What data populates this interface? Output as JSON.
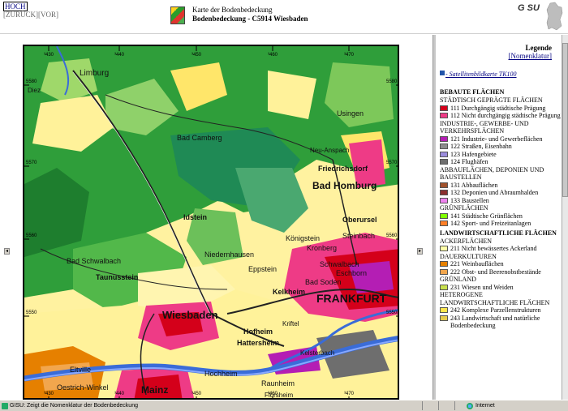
{
  "header": {
    "nav": {
      "hoch": "HOCH",
      "zurueck": "[ZURÜCK]",
      "vor": "[VOR]"
    },
    "subtitle": "Karte der Bodenbedeckung",
    "title": "Bodenbedeckung - C5914 Wiesbaden",
    "logo_text": "G SU"
  },
  "map": {
    "grid_top": [
      "³430",
      "³440",
      "³450",
      "³460",
      "³470"
    ],
    "grid_bottom": [
      "³430",
      "³440",
      "³450",
      "³460",
      "³470"
    ],
    "grid_left": [
      "5580",
      "5570",
      "5560",
      "5550"
    ],
    "grid_right": [
      "5580",
      "5570",
      "5560",
      "5550"
    ],
    "places": [
      "Limburg",
      "Idstein",
      "Usingen",
      "Bad Camberg",
      "Neu-Anspach",
      "Friedrichsdorf",
      "Bad Homburg",
      "Oberursel",
      "Königstein",
      "Kronberg",
      "Steinbach",
      "Niedernhausen",
      "Bad Schwalbach",
      "Taunusstein",
      "Eppstein",
      "Schwalbach",
      "Eschborn",
      "Bad Soden",
      "Kelkheim",
      "FRANKFURT",
      "Wiesbaden",
      "Hofheim",
      "Hattersheim",
      "Kriftel",
      "Kelsterbach",
      "Eltville",
      "Oestrich-Winkel",
      "Hochheim",
      "Raunheim",
      "Flörsheim",
      "Mainz",
      "Diez"
    ]
  },
  "legend": {
    "title": "Legende",
    "nomenklatur_link": "[Nomenklatur]",
    "satellite_link": "- Satellitenbildkarte TK100",
    "items": [
      {
        "kind": "h1",
        "text": "BEBAUTE FLÄCHEN"
      },
      {
        "kind": "h2",
        "text": "STÄDTISCH GEPRÄGTE FLÄCHEN"
      },
      {
        "kind": "item",
        "text": "111 Durchgängig städtische Prägung",
        "color": "#d4001a"
      },
      {
        "kind": "item",
        "text": "112 Nicht durchgängig städtische Prägung",
        "color": "#ee3b86"
      },
      {
        "kind": "h2",
        "text": "INDUSTRIE-, GEWERBE- UND VERKEHRSFLÄCHEN"
      },
      {
        "kind": "item",
        "text": "121 Industrie- und Gewerbeflächen",
        "color": "#b41eb4"
      },
      {
        "kind": "item",
        "text": "122 Straßen, Eisenbahn",
        "color": "#8c8c8c"
      },
      {
        "kind": "item",
        "text": "123 Hafengebiete",
        "color": "#9b8cdc"
      },
      {
        "kind": "item",
        "text": "124 Flughäfen",
        "color": "#6e6e6e"
      },
      {
        "kind": "h2",
        "text": "ABBAUFLÄCHEN, DEPONIEN UND BAUSTELLEN"
      },
      {
        "kind": "item",
        "text": "131 Abbauflächen",
        "color": "#a0522d"
      },
      {
        "kind": "item",
        "text": "132 Deponien und Abraumhalden",
        "color": "#8b3030"
      },
      {
        "kind": "item",
        "text": "133 Baustellen",
        "color": "#ee82ee"
      },
      {
        "kind": "h2",
        "text": "GRÜNFLÄCHEN"
      },
      {
        "kind": "item",
        "text": "141 Städtische Grünflächen",
        "color": "#7fff00"
      },
      {
        "kind": "item",
        "text": "142 Sport- und Freizeitanlagen",
        "color": "#ff7f27"
      },
      {
        "kind": "h1",
        "text": "LANDWIRTSCHAFTLICHE FLÄCHEN"
      },
      {
        "kind": "h2",
        "text": "ACKERFLÄCHEN"
      },
      {
        "kind": "item",
        "text": "211 Nicht bewässertes Ackerland",
        "color": "#ffffa8"
      },
      {
        "kind": "h2",
        "text": "DAUERKULTUREN"
      },
      {
        "kind": "item",
        "text": "221 Weinbauflächen",
        "color": "#e68000"
      },
      {
        "kind": "item",
        "text": "222 Obst- und Beerenobstbestände",
        "color": "#f2a64d"
      },
      {
        "kind": "h2",
        "text": "GRÜNLAND"
      },
      {
        "kind": "item",
        "text": "231 Wiesen und Weiden",
        "color": "#c8e04d"
      },
      {
        "kind": "h2",
        "text": "HETEROGENE LANDWIRTSCHAFTLICHE FLÄCHEN"
      },
      {
        "kind": "item",
        "text": "242 Komplexe Parzellenstrukturen",
        "color": "#ffe64d"
      },
      {
        "kind": "item",
        "text": "243 Landwirtschaft und natürliche Bodenbedeckung",
        "color": "#e6cc4d"
      }
    ]
  },
  "status": {
    "text": "GISU: Zeigt die Nomenklatur der Bodenbedeckung",
    "zone": "Internet"
  }
}
